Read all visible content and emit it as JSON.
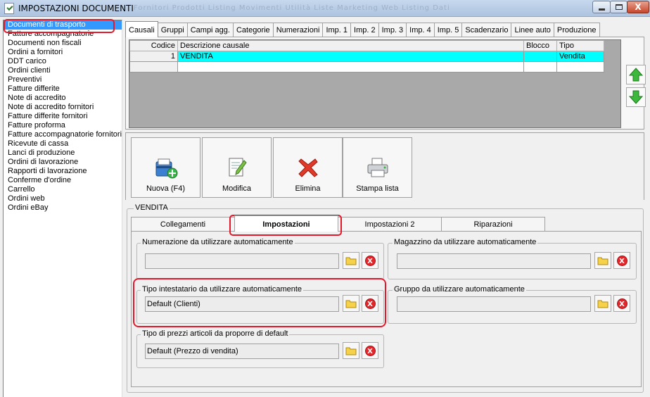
{
  "window": {
    "title": "IMPOSTAZIONI DOCUMENTI",
    "ghost_menu": "Fornitori   Prodotti   Listing   Movimenti   Utilità   Liste   Marketing   Web   Listing   Dati",
    "close_glyph": "X"
  },
  "sidebar": {
    "items": [
      {
        "label": "Documenti di trasporto"
      },
      {
        "label": "Fatture accompagnatorie"
      },
      {
        "label": "Documenti non fiscali"
      },
      {
        "label": "Ordini a fornitori"
      },
      {
        "label": "DDT carico"
      },
      {
        "label": "Ordini clienti"
      },
      {
        "label": "Preventivi"
      },
      {
        "label": "Fatture differite"
      },
      {
        "label": "Note di accredito"
      },
      {
        "label": "Note di accredito fornitori"
      },
      {
        "label": "Fatture differite fornitori"
      },
      {
        "label": "Fatture proforma"
      },
      {
        "label": "Fatture accompagnatorie fornitori"
      },
      {
        "label": "Ricevute di cassa"
      },
      {
        "label": "Lanci di produzione"
      },
      {
        "label": "Ordini di lavorazione"
      },
      {
        "label": "Rapporti di lavorazione"
      },
      {
        "label": "Conferme d'ordine"
      },
      {
        "label": "Carrello"
      },
      {
        "label": "Ordini web"
      },
      {
        "label": "Ordini eBay"
      }
    ],
    "selected_index": 0
  },
  "tabs": [
    {
      "label": "Causali"
    },
    {
      "label": "Gruppi"
    },
    {
      "label": "Campi agg."
    },
    {
      "label": "Categorie"
    },
    {
      "label": "Numerazioni"
    },
    {
      "label": "Imp. 1"
    },
    {
      "label": "Imp. 2"
    },
    {
      "label": "Imp. 3"
    },
    {
      "label": "Imp. 4"
    },
    {
      "label": "Imp. 5"
    },
    {
      "label": "Scadenzario"
    },
    {
      "label": "Linee auto"
    },
    {
      "label": "Produzione"
    }
  ],
  "causali_table": {
    "columns": [
      "Codice",
      "Descrizione causale",
      "Blocco",
      "Tipo"
    ],
    "rows": [
      {
        "codice": "1",
        "descrizione": "VENDITA",
        "blocco": "",
        "tipo": "Vendita"
      }
    ]
  },
  "toolbar": {
    "new_label": "Nuova (F4)",
    "edit_label": "Modifica",
    "delete_label": "Elimina",
    "print_label": "Stampa lista"
  },
  "detail": {
    "group_title": "VENDITA",
    "tabs": [
      {
        "label": "Collegamenti"
      },
      {
        "label": "Impostazioni"
      },
      {
        "label": "Impostazioni 2"
      },
      {
        "label": "Riparazioni"
      }
    ],
    "fields": {
      "numerazione": {
        "label": "Numerazione da utilizzare automaticamente",
        "value": ""
      },
      "magazzino": {
        "label": "Magazzino da utilizzare automaticamente",
        "value": ""
      },
      "tipo_intestatario": {
        "label": "Tipo intestatario da utilizzare automaticamente",
        "value": "Default (Clienti)"
      },
      "gruppo": {
        "label": "Gruppo da utilizzare automaticamente",
        "value": ""
      },
      "tipo_prezzi": {
        "label": "Tipo di prezzi articoli da proporre di default",
        "value": "Default (Prezzo di vendita)"
      }
    },
    "delete_glyph": "X"
  },
  "colors": {
    "selection": "#3399ff",
    "row_highlight": "#00ffff",
    "annotation": "#e3192b"
  }
}
